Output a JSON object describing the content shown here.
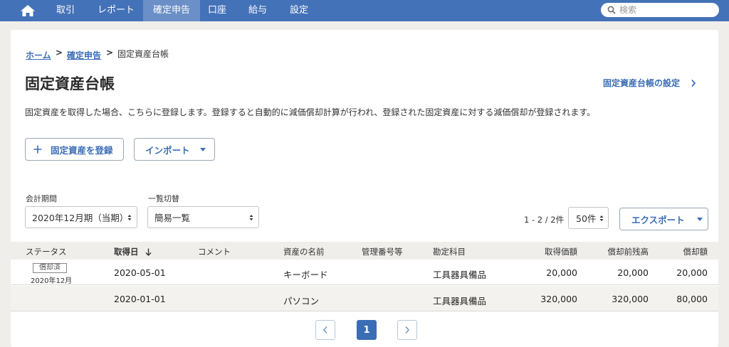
{
  "nav": {
    "items": [
      "取引",
      "レポート",
      "確定申告",
      "口座",
      "給与",
      "設定"
    ],
    "active": "確定申告",
    "search_placeholder": "検索"
  },
  "breadcrumb": {
    "home": "ホーム",
    "parent": "確定申告",
    "current": "固定資産台帳",
    "sep": ">"
  },
  "page": {
    "title": "固定資産台帳",
    "settings_link": "固定資産台帳の設定",
    "description": "固定資産を取得した場合、こちらに登録します。登録すると自動的に減価償却計算が行われ、登録された固定資産に対する減価償却が登録されます。"
  },
  "actions": {
    "register": "固定資産を登録",
    "import": "インポート",
    "export": "エクスポート"
  },
  "filters": {
    "period_label": "会計期間",
    "period_value": "2020年12月期（当期）",
    "view_label": "一覧切替",
    "view_value": "簡易一覧"
  },
  "list_meta": {
    "count": "1 - 2 / 2件",
    "per_page": "50件"
  },
  "table": {
    "headers": {
      "status": "ステータス",
      "acquired": "取得日",
      "comment": "コメント",
      "name": "資産の名前",
      "mgmt_no": "管理番号等",
      "account": "勘定科目",
      "price": "取得価額",
      "balance": "償却前残高",
      "depreciation": "償却額"
    },
    "rows": [
      {
        "badge": "償却済",
        "status_date": "2020年12月",
        "acquired": "2020-05-01",
        "comment": "",
        "name": "キーボード",
        "mgmt_no": "",
        "account": "工具器具備品",
        "price": "20,000",
        "balance": "20,000",
        "depreciation": "20,000"
      },
      {
        "badge": "",
        "status_date": "",
        "acquired": "2020-01-01",
        "comment": "",
        "name": "パソコン",
        "mgmt_no": "",
        "account": "工具器具備品",
        "price": "320,000",
        "balance": "320,000",
        "depreciation": "80,000"
      }
    ]
  },
  "pagination": {
    "current": "1"
  },
  "colors": {
    "nav_bg": "#4472b8",
    "nav_active": "#6b8fc7",
    "link": "#3b6db5",
    "page_bg": "#f0eeeb"
  }
}
